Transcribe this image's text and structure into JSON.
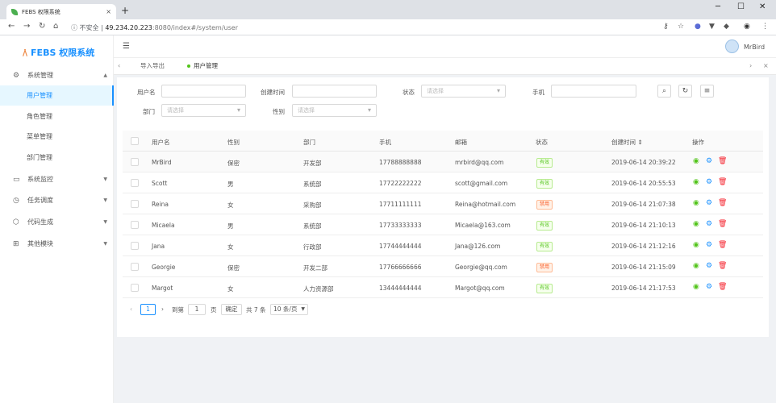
{
  "browser": {
    "tab_title": "FEBS 权限系统",
    "tab_close": "×",
    "new_tab": "+",
    "win_min": "─",
    "win_max": "☐",
    "win_close": "✕",
    "security_label": "不安全",
    "url_host": "49.234.20.223",
    "url_rest": ":8080/index#/system/user"
  },
  "app": {
    "logo_mark": "/\\",
    "logo_text": "FEBS 权限系统",
    "username": "MrBird"
  },
  "sidebar": {
    "items": [
      {
        "label": "系统管理",
        "icon": "gear-icon",
        "expanded": true
      },
      {
        "label": "系统监控",
        "icon": "monitor-icon"
      },
      {
        "label": "任务调度",
        "icon": "clock-icon"
      },
      {
        "label": "代码生成",
        "icon": "cube-icon"
      },
      {
        "label": "其他模块",
        "icon": "gift-icon"
      }
    ],
    "sub_items": [
      {
        "label": "用户管理",
        "active": true
      },
      {
        "label": "角色管理"
      },
      {
        "label": "菜单管理"
      },
      {
        "label": "部门管理"
      }
    ]
  },
  "tabs": [
    {
      "label": "导入导出"
    },
    {
      "label": "用户管理",
      "active": true
    }
  ],
  "search": {
    "username_label": "用户名",
    "created_label": "创建时间",
    "status_label": "状态",
    "status_placeholder": "请选择",
    "phone_label": "手机",
    "dept_label": "部门",
    "dept_placeholder": "请选择",
    "gender_label": "性别",
    "gender_placeholder": "请选择"
  },
  "table": {
    "columns": [
      "用户名",
      "性别",
      "部门",
      "手机",
      "邮箱",
      "状态",
      "创建时间 ⇕",
      "操作"
    ],
    "rows": [
      {
        "username": "MrBird",
        "gender": "保密",
        "dept": "开发部",
        "phone": "17788888888",
        "email": "mrbird@qq.com",
        "status": "有效",
        "status_type": "ok",
        "created": "2019-06-14 20:39:22"
      },
      {
        "username": "Scott",
        "gender": "男",
        "dept": "系统部",
        "phone": "17722222222",
        "email": "scott@gmail.com",
        "status": "有效",
        "status_type": "ok",
        "created": "2019-06-14 20:55:53"
      },
      {
        "username": "Reina",
        "gender": "女",
        "dept": "采购部",
        "phone": "17711111111",
        "email": "Reina@hotmail.com",
        "status": "禁用",
        "status_type": "ban",
        "created": "2019-06-14 21:07:38"
      },
      {
        "username": "Micaela",
        "gender": "男",
        "dept": "系统部",
        "phone": "17733333333",
        "email": "Micaela@163.com",
        "status": "有效",
        "status_type": "ok",
        "created": "2019-06-14 21:10:13"
      },
      {
        "username": "Jana",
        "gender": "女",
        "dept": "行政部",
        "phone": "17744444444",
        "email": "Jana@126.com",
        "status": "有效",
        "status_type": "ok",
        "created": "2019-06-14 21:12:16"
      },
      {
        "username": "Georgie",
        "gender": "保密",
        "dept": "开发二部",
        "phone": "17766666666",
        "email": "Georgie@qq.com",
        "status": "禁用",
        "status_type": "ban",
        "created": "2019-06-14 21:15:09"
      },
      {
        "username": "Margot",
        "gender": "女",
        "dept": "人力资源部",
        "phone": "13444444444",
        "email": "Margot@qq.com",
        "status": "有效",
        "status_type": "ok",
        "created": "2019-06-14 21:17:53"
      }
    ]
  },
  "pagination": {
    "current_page": "1",
    "goto_label": "到第",
    "goto_value": "1",
    "page_unit": "页",
    "confirm": "确定",
    "total": "共 7 条",
    "page_size": "10 条/页"
  },
  "colors": {
    "primary": "#1890ff",
    "success": "#52c41a",
    "danger": "#fa541c"
  }
}
